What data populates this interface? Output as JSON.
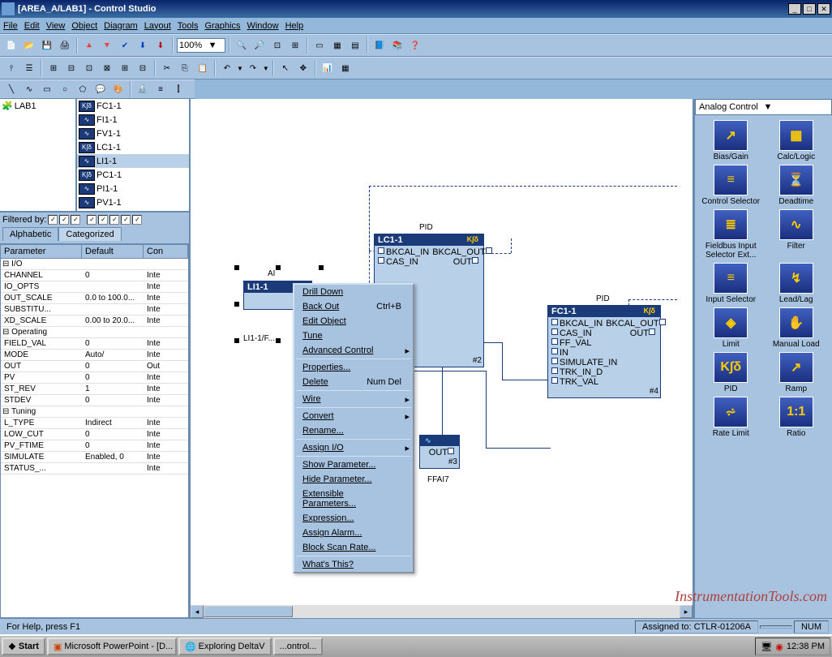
{
  "title": "[AREA_A/LAB1] - Control Studio",
  "menus": [
    "File",
    "Edit",
    "View",
    "Object",
    "Diagram",
    "Layout",
    "Tools",
    "Graphics",
    "Window",
    "Help"
  ],
  "zoom": "100%",
  "tree": {
    "root": "LAB1"
  },
  "fb_list": [
    {
      "icon": "K∫δ",
      "name": "FC1-1"
    },
    {
      "icon": "∿",
      "name": "FI1-1"
    },
    {
      "icon": "∿",
      "name": "FV1-1"
    },
    {
      "icon": "K∫δ",
      "name": "LC1-1"
    },
    {
      "icon": "∿",
      "name": "LI1-1",
      "selected": true
    },
    {
      "icon": "K∫δ",
      "name": "PC1-1"
    },
    {
      "icon": "∿",
      "name": "PI1-1"
    },
    {
      "icon": "∿",
      "name": "PV1-1"
    }
  ],
  "filter_label": "Filtered by:",
  "tabs": {
    "alpha": "Alphabetic",
    "cat": "Categorized"
  },
  "param_headers": {
    "param": "Parameter",
    "default": "Default",
    "con": "Con"
  },
  "param_groups": [
    {
      "name": "I/O",
      "rows": [
        {
          "n": "CHANNEL",
          "d": "0",
          "c": "Inte"
        },
        {
          "n": "IO_OPTS",
          "d": "",
          "c": "Inte"
        },
        {
          "n": "OUT_SCALE",
          "d": "0.0 to 100.0...",
          "c": "Inte"
        },
        {
          "n": "SUBSTITU...",
          "d": "",
          "c": "Inte"
        },
        {
          "n": "XD_SCALE",
          "d": "0.00 to 20.0...",
          "c": "Inte"
        }
      ]
    },
    {
      "name": "Operating",
      "rows": [
        {
          "n": "FIELD_VAL",
          "d": "0",
          "c": "Inte"
        },
        {
          "n": "MODE",
          "d": "Auto/",
          "c": "Inte"
        },
        {
          "n": "OUT",
          "d": "0",
          "c": "Out"
        },
        {
          "n": "PV",
          "d": "0",
          "c": "Inte"
        },
        {
          "n": "ST_REV",
          "d": "1",
          "c": "Inte"
        },
        {
          "n": "STDEV",
          "d": "0",
          "c": "Inte"
        }
      ]
    },
    {
      "name": "Tuning",
      "rows": [
        {
          "n": "L_TYPE",
          "d": "Indirect",
          "c": "Inte"
        },
        {
          "n": "LOW_CUT",
          "d": "0",
          "c": "Inte"
        },
        {
          "n": "PV_FTIME",
          "d": "0",
          "c": "Inte"
        },
        {
          "n": "SIMULATE",
          "d": "Enabled, 0",
          "c": "Inte"
        },
        {
          "n": "STATUS_...",
          "d": "",
          "c": "Inte"
        }
      ]
    }
  ],
  "ai_block": {
    "label": "AI",
    "name": "LI1-1",
    "ref": "LI1-1/F..."
  },
  "lc_block": {
    "type": "PID",
    "name": "LC1-1",
    "num": "#2",
    "pins": [
      "BKCAL_IN",
      "BKCAL_OUT",
      "CAS_IN",
      "OUT"
    ]
  },
  "fc_block": {
    "type": "PID",
    "name": "FC1-1",
    "num": "#4",
    "pins": [
      "BKCAL_IN",
      "BKCAL_OUT",
      "CAS_IN",
      "OUT",
      "FF_VAL",
      "IN",
      "SIMULATE_IN",
      "TRK_IN_D",
      "TRK_VAL"
    ]
  },
  "ao_block": {
    "num": "#3",
    "ref": "FFAI7",
    "pin": "OUT"
  },
  "context_menu": [
    {
      "t": "Drill Down"
    },
    {
      "t": "Back Out",
      "s": "Ctrl+B"
    },
    {
      "t": "Edit Object"
    },
    {
      "t": "Tune"
    },
    {
      "t": "Advanced Control",
      "sub": true
    },
    {
      "sep": true
    },
    {
      "t": "Properties..."
    },
    {
      "t": "Delete",
      "s": "Num Del"
    },
    {
      "sep": true
    },
    {
      "t": "Wire",
      "sub": true
    },
    {
      "sep": true
    },
    {
      "t": "Convert",
      "sub": true
    },
    {
      "t": "Rename..."
    },
    {
      "sep": true
    },
    {
      "t": "Assign I/O",
      "sub": true
    },
    {
      "sep": true
    },
    {
      "t": "Show Parameter..."
    },
    {
      "t": "Hide Parameter..."
    },
    {
      "t": "Extensible Parameters..."
    },
    {
      "t": "Expression..."
    },
    {
      "t": "Assign Alarm..."
    },
    {
      "t": "Block Scan Rate..."
    },
    {
      "sep": true
    },
    {
      "t": "What's This?"
    }
  ],
  "palette_title": "Analog Control",
  "palette": [
    {
      "label": "Bias/Gain",
      "g": "↗"
    },
    {
      "label": "Calc/Logic",
      "g": "▦"
    },
    {
      "label": "Control Selector",
      "g": "≡"
    },
    {
      "label": "Deadtime",
      "g": "⏳"
    },
    {
      "label": "Fieldbus Input Selector Ext...",
      "g": "≣"
    },
    {
      "label": "Filter",
      "g": "∿"
    },
    {
      "label": "Input Selector",
      "g": "≡"
    },
    {
      "label": "Lead/Lag",
      "g": "↯"
    },
    {
      "label": "Limit",
      "g": "◈"
    },
    {
      "label": "Manual Load",
      "g": "✋"
    },
    {
      "label": "PID",
      "g": "K∫δ"
    },
    {
      "label": "Ramp",
      "g": "↗"
    },
    {
      "label": "Rate Limit",
      "g": "⩫"
    },
    {
      "label": "Ratio",
      "g": "1:1"
    }
  ],
  "status": {
    "help": "For Help, press F1",
    "assigned": "Assigned to: CTLR-01206A",
    "num": "NUM"
  },
  "taskbar": {
    "start": "Start",
    "items": [
      "Microsoft PowerPoint - [D...",
      "Exploring DeltaV",
      "...ontrol..."
    ],
    "time": "12:38 PM"
  },
  "watermark": "InstrumentationTools.com"
}
